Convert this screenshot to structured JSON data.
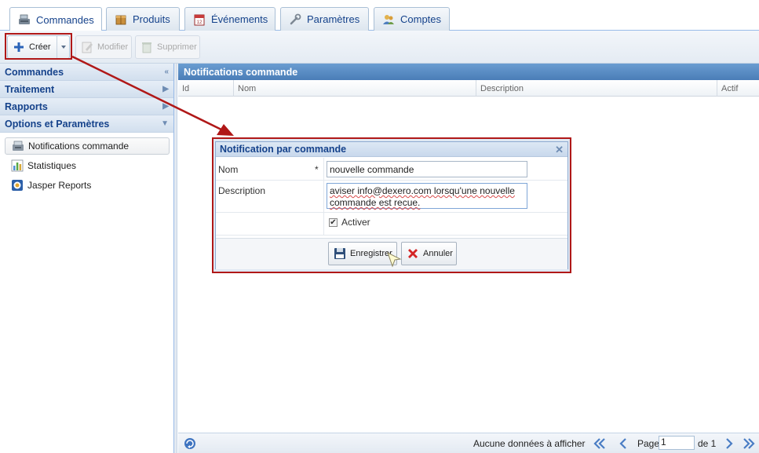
{
  "tabs": [
    {
      "label": "Commandes",
      "icon": "register-icon",
      "active": true
    },
    {
      "label": "Produits",
      "icon": "box-icon",
      "active": false
    },
    {
      "label": "Événements",
      "icon": "calendar-icon",
      "active": false
    },
    {
      "label": "Paramètres",
      "icon": "wrench-icon",
      "active": false
    },
    {
      "label": "Comptes",
      "icon": "users-icon",
      "active": false
    }
  ],
  "toolbar": {
    "create_label": "Créer",
    "modify_label": "Modifier",
    "delete_label": "Supprimer"
  },
  "sidebar": {
    "sections": [
      {
        "label": "Commandes",
        "arrow": "«"
      },
      {
        "label": "Traitement",
        "arrow": "▶"
      },
      {
        "label": "Rapports",
        "arrow": "▶"
      },
      {
        "label": "Options et Paramètres",
        "arrow": "▼"
      }
    ],
    "items": [
      {
        "label": "Notifications commande",
        "icon": "notification-icon",
        "selected": true
      },
      {
        "label": "Statistiques",
        "icon": "bar-chart-icon",
        "selected": false
      },
      {
        "label": "Jasper Reports",
        "icon": "report-icon",
        "selected": false
      }
    ]
  },
  "grid": {
    "title": "Notifications commande",
    "columns": [
      "Id",
      "Nom",
      "Description",
      "Actif"
    ]
  },
  "pager": {
    "empty_message": "Aucune données à afficher",
    "page_label": "Page",
    "page_value": "1",
    "of_label": "de 1"
  },
  "dialog": {
    "title": "Notification par commande",
    "close_glyph": "✕",
    "name_label": "Nom",
    "required_mark": "*",
    "name_value": "nouvelle commande",
    "description_label": "Description",
    "description_value": "aviser info@dexero.com lorsqu'une nouvelle commande est recue.",
    "active_label": "Activer",
    "active_checked": true,
    "check_glyph": "✔",
    "save_label": "Enregistrer",
    "cancel_label": "Annuler"
  },
  "colors": {
    "accent": "#15428b",
    "header_blue": "#4a7db7",
    "highlight_red": "#b01818"
  }
}
